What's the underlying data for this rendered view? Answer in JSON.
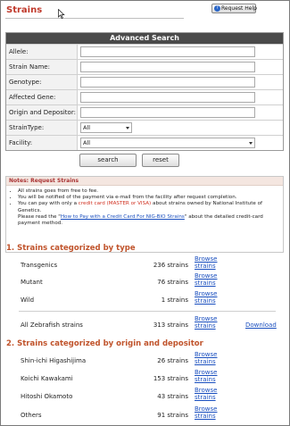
{
  "page": {
    "title": "Strains",
    "help_label": "Request Help"
  },
  "search": {
    "header": "Advanced Search",
    "fields": [
      {
        "label": "Allele:",
        "value": ""
      },
      {
        "label": "Strain Name:",
        "value": ""
      },
      {
        "label": "Genotype:",
        "value": ""
      },
      {
        "label": "Affected Gene:",
        "value": ""
      },
      {
        "label": "Origin and Depositor:",
        "value": ""
      }
    ],
    "strain_type": {
      "label": "StrainType:",
      "selected": "All"
    },
    "facility": {
      "label": "Facility:",
      "selected": "All"
    },
    "search_label": "search",
    "reset_label": "reset"
  },
  "notes": {
    "title": "Notes: Request Strains",
    "items": [
      "All strains goes from free to fee.",
      "You will be notified of the payment via e-mail from the facility after request completion.",
      "You can pay with only a",
      "credit card (MASTER or VISA)",
      "about strains owned by National Institute of Genetics."
    ],
    "please_pre": "Please read the \"",
    "link_text": "How to Pay with a Credit Card For NIG-BIO Strains",
    "please_post": "\" about the detailed credit-card payment method."
  },
  "by_type": {
    "title": "1. Strains categorized by type",
    "rows": [
      {
        "name": "Transgenics",
        "count": "236 strains",
        "browse": "Browse strains"
      },
      {
        "name": "Mutant",
        "count": "76 strains",
        "browse": "Browse strains"
      },
      {
        "name": "Wild",
        "count": "1 strains",
        "browse": "Browse strains"
      }
    ],
    "all": {
      "name": "All Zebrafish strains",
      "count": "313 strains",
      "browse": "Browse strains",
      "download": "Download"
    }
  },
  "by_origin": {
    "title": "2. Strains categorized by origin and depositor",
    "rows": [
      {
        "name": "Shin-ichi Higashijima",
        "count": "26 strains",
        "browse": "Browse strains"
      },
      {
        "name": "Koichi Kawakami",
        "count": "153 strains",
        "browse": "Browse strains"
      },
      {
        "name": "Hitoshi Okamoto",
        "count": "43 strains",
        "browse": "Browse strains"
      },
      {
        "name": "Others",
        "count": "91 strains",
        "browse": "Browse strains"
      }
    ]
  }
}
